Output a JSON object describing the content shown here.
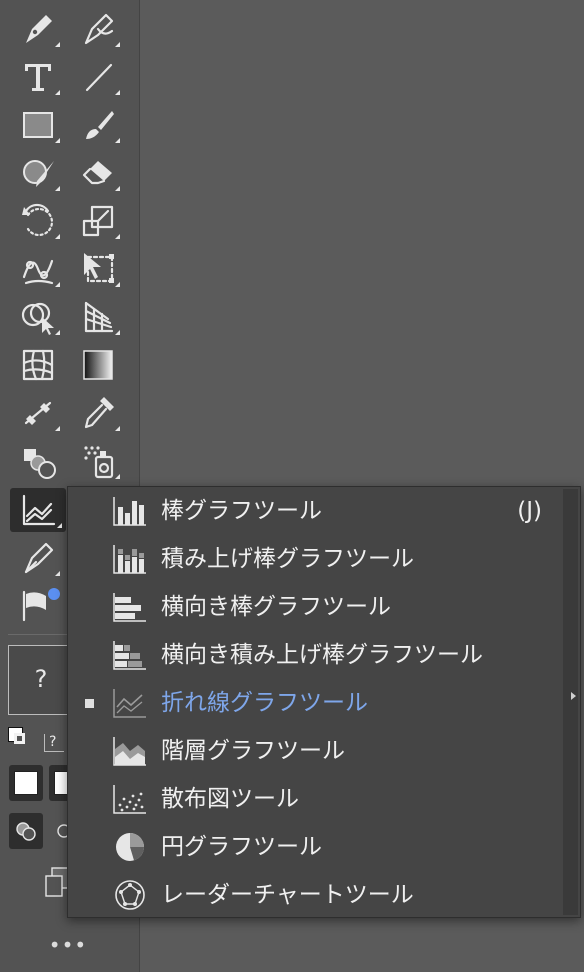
{
  "toolbar": {
    "tools": [
      {
        "name": "pen-tool-icon",
        "has_flyout": true
      },
      {
        "name": "curvature-tool-icon",
        "has_flyout": true
      },
      {
        "name": "type-tool-icon",
        "has_flyout": true
      },
      {
        "name": "line-segment-tool-icon",
        "has_flyout": true
      },
      {
        "name": "rectangle-tool-icon",
        "has_flyout": true
      },
      {
        "name": "paintbrush-tool-icon",
        "has_flyout": true
      },
      {
        "name": "shaper-tool-icon",
        "has_flyout": true
      },
      {
        "name": "eraser-tool-icon",
        "has_flyout": true
      },
      {
        "name": "rotate-tool-icon",
        "has_flyout": true
      },
      {
        "name": "scale-tool-icon",
        "has_flyout": true
      },
      {
        "name": "puppet-warp-tool-icon",
        "has_flyout": true
      },
      {
        "name": "free-transform-tool-icon",
        "has_flyout": true
      },
      {
        "name": "shape-builder-tool-icon",
        "has_flyout": true
      },
      {
        "name": "perspective-grid-tool-icon",
        "has_flyout": true
      },
      {
        "name": "mesh-tool-icon",
        "has_flyout": false
      },
      {
        "name": "gradient-tool-icon",
        "has_flyout": false
      },
      {
        "name": "eyedropper-tool-icon",
        "has_flyout": true
      },
      {
        "name": "measure-eyedropper-icon",
        "has_flyout": true
      },
      {
        "name": "blend-tool-icon",
        "has_flyout": false
      },
      {
        "name": "symbol-sprayer-tool-icon",
        "has_flyout": true
      },
      {
        "name": "graph-tool-icon",
        "has_flyout": true,
        "selected": true
      },
      {
        "name": "pen-edit-tool-icon",
        "has_flyout": true
      },
      {
        "name": "flag-tool-icon",
        "has_flyout": false
      }
    ],
    "unknown_tool_label": "?",
    "small_question_label": "?",
    "more_label": "•••"
  },
  "flyout": {
    "items": [
      {
        "icon": "column-graph-icon",
        "label": "棒グラフツール",
        "shortcut": "(J)",
        "active": false
      },
      {
        "icon": "stacked-column-graph-icon",
        "label": "積み上げ棒グラフツール",
        "shortcut": "",
        "active": false
      },
      {
        "icon": "bar-graph-icon",
        "label": "横向き棒グラフツール",
        "shortcut": "",
        "active": false
      },
      {
        "icon": "stacked-bar-graph-icon",
        "label": "横向き積み上げ棒グラフツール",
        "shortcut": "",
        "active": false
      },
      {
        "icon": "line-graph-icon",
        "label": "折れ線グラフツール",
        "shortcut": "",
        "active": true
      },
      {
        "icon": "area-graph-icon",
        "label": "階層グラフツール",
        "shortcut": "",
        "active": false
      },
      {
        "icon": "scatter-graph-icon",
        "label": "散布図ツール",
        "shortcut": "",
        "active": false
      },
      {
        "icon": "pie-graph-icon",
        "label": "円グラフツール",
        "shortcut": "",
        "active": false
      },
      {
        "icon": "radar-graph-icon",
        "label": "レーダーチャートツール",
        "shortcut": "",
        "active": false
      }
    ],
    "active_color": "#7ea6ea"
  },
  "colors": {
    "toolbar_bg": "#535353",
    "canvas_bg": "#5b5b5b",
    "menu_bg": "#454545",
    "accent_dot": "#5b8ff0"
  }
}
